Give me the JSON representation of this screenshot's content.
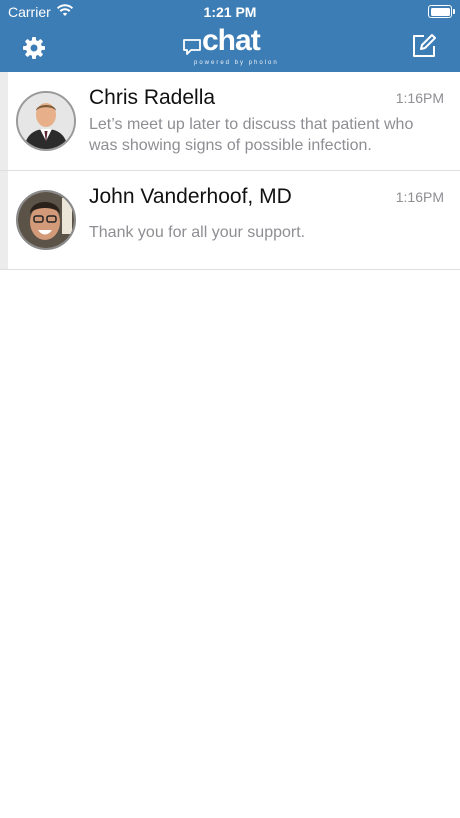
{
  "status_bar": {
    "carrier": "Carrier",
    "time": "1:21 PM"
  },
  "nav": {
    "logo_text": "chat",
    "logo_subtitle": "powered by pholon",
    "settings_icon": "gear-icon",
    "compose_icon": "compose-icon"
  },
  "conversations": [
    {
      "name": "Chris Radella",
      "time": "1:16PM",
      "preview": "Let’s meet up later to discuss that patient who was showing signs of possible infection."
    },
    {
      "name": "John Vanderhoof, MD",
      "time": "1:16PM",
      "preview": "Thank you for all your support."
    }
  ],
  "colors": {
    "header": "#3d7db5",
    "accent_text": "#8e8e93"
  }
}
